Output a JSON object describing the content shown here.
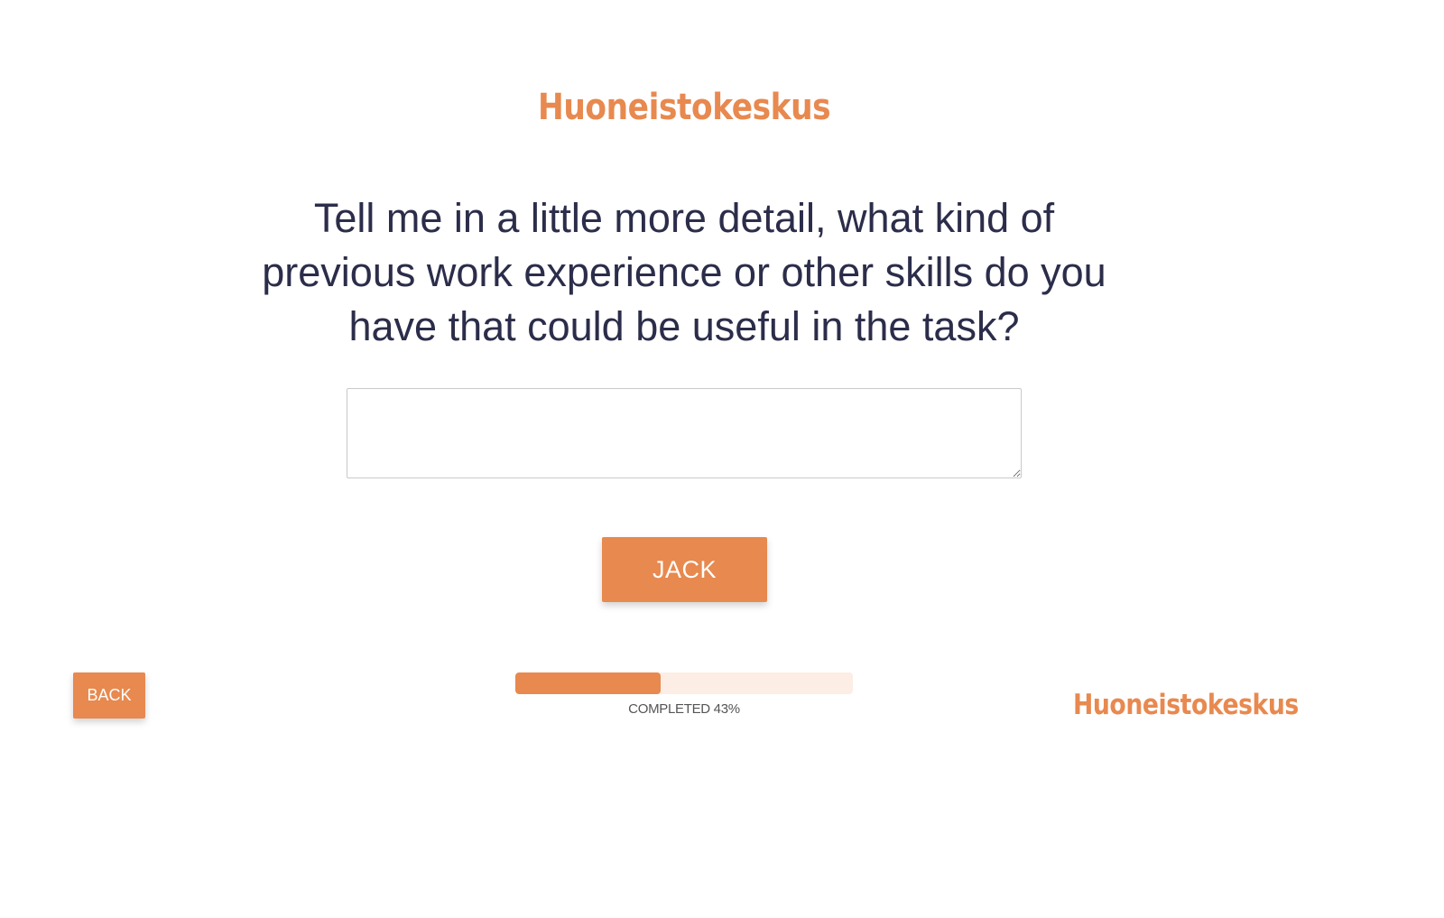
{
  "brand": {
    "logo_top": "Huoneistokeskus",
    "logo_bottom": "Huoneistokeskus",
    "accent_color": "#e8894f"
  },
  "question": {
    "text": "Tell me in a little more detail, what kind of previous work experience or other skills do you have that could be useful in the task?"
  },
  "answer": {
    "value": "",
    "placeholder": ""
  },
  "actions": {
    "submit_label": "JACK",
    "back_label": "BACK"
  },
  "progress": {
    "percent": 43,
    "label": "COMPLETED 43%"
  }
}
